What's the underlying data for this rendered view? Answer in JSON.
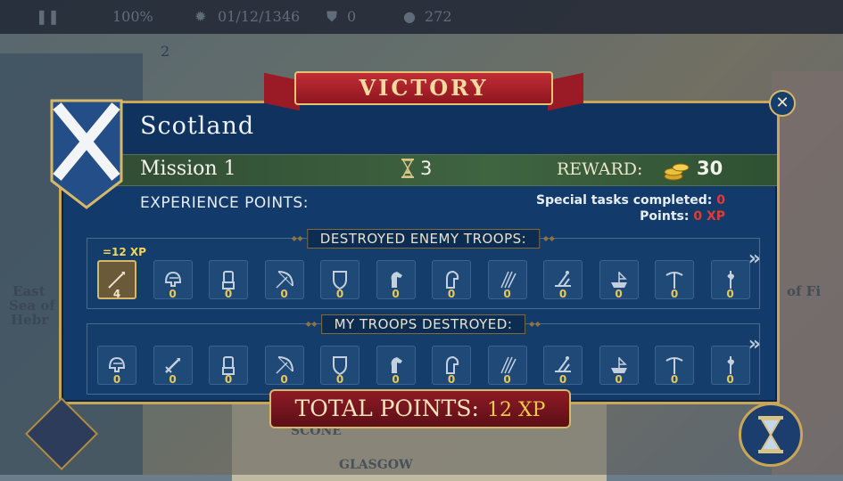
{
  "topbar": {
    "game_speed": "100%",
    "date": "01/12/1346",
    "stat_shield": "0",
    "stat_money": "272",
    "slot_number": "2"
  },
  "map_labels": [
    "East",
    "Sea of",
    "Hebr",
    "SCONE",
    "GLASGOW",
    "of Fi"
  ],
  "banner": {
    "title": "VICTORY"
  },
  "panel": {
    "country": "Scotland",
    "mission": "Mission 1",
    "turns": "3",
    "reward_label": "REWARD:",
    "reward_value": "30",
    "xp_label": "EXPERIENCE POINTS:",
    "special_label": "Special tasks completed:",
    "special_value": "0",
    "points_label": "Points:",
    "points_value": "0 XP"
  },
  "destroyed_enemy": {
    "title": "DESTROYED ENEMY TROOPS:",
    "xp_tag": "=12 XP",
    "units": [
      {
        "icon": "spear-icon",
        "count": "4"
      },
      {
        "icon": "helmet-icon",
        "count": "0"
      },
      {
        "icon": "gauntlet-icon",
        "count": "0"
      },
      {
        "icon": "bow-icon",
        "count": "0"
      },
      {
        "icon": "shield-icon",
        "count": "0"
      },
      {
        "icon": "horse-icon",
        "count": "0"
      },
      {
        "icon": "armored-horse-icon",
        "count": "0"
      },
      {
        "icon": "pikes-icon",
        "count": "0"
      },
      {
        "icon": "catapult-icon",
        "count": "0"
      },
      {
        "icon": "ship-icon",
        "count": "0"
      },
      {
        "icon": "crossbow-icon",
        "count": "0"
      },
      {
        "icon": "halberd-icon",
        "count": "0"
      }
    ]
  },
  "my_destroyed": {
    "title": "MY TROOPS DESTROYED:",
    "units": [
      {
        "icon": "helmet-icon",
        "count": "0"
      },
      {
        "icon": "sword-icon",
        "count": "0"
      },
      {
        "icon": "gauntlet-icon",
        "count": "0"
      },
      {
        "icon": "bow-icon",
        "count": "0"
      },
      {
        "icon": "shield-icon",
        "count": "0"
      },
      {
        "icon": "horse-icon",
        "count": "0"
      },
      {
        "icon": "armored-horse-icon",
        "count": "0"
      },
      {
        "icon": "pikes-icon",
        "count": "0"
      },
      {
        "icon": "catapult-icon",
        "count": "0"
      },
      {
        "icon": "ship-icon",
        "count": "0"
      },
      {
        "icon": "crossbow-icon",
        "count": "0"
      },
      {
        "icon": "halberd-icon",
        "count": "0"
      }
    ]
  },
  "total": {
    "label": "TOTAL POINTS:",
    "value": "12 XP"
  },
  "colors": {
    "panel": "#123a6a",
    "gold": "#c9a757",
    "banner_red": "#b3242d",
    "count_gold": "#e7c85b",
    "accent_red": "#e23b33"
  }
}
